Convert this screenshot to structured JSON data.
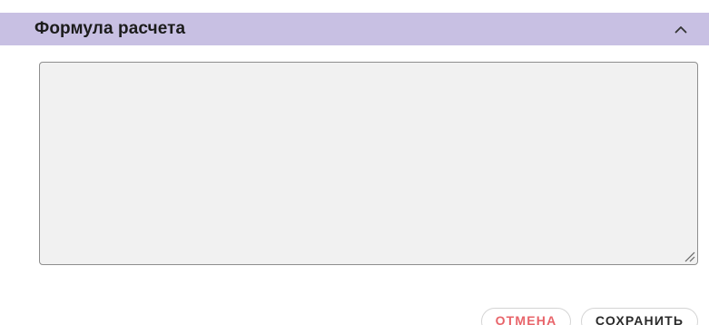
{
  "section": {
    "title": "Формула расчета",
    "collapse_icon": "chevron-up-icon"
  },
  "formula": {
    "value": "",
    "placeholder": ""
  },
  "actions": {
    "cancel_label": "ОТМЕНА",
    "save_label": "СОХРАНИТЬ"
  },
  "colors": {
    "header_background": "#c8c0e3",
    "cancel_text": "#e8646a",
    "field_background": "#f1f1f1"
  }
}
